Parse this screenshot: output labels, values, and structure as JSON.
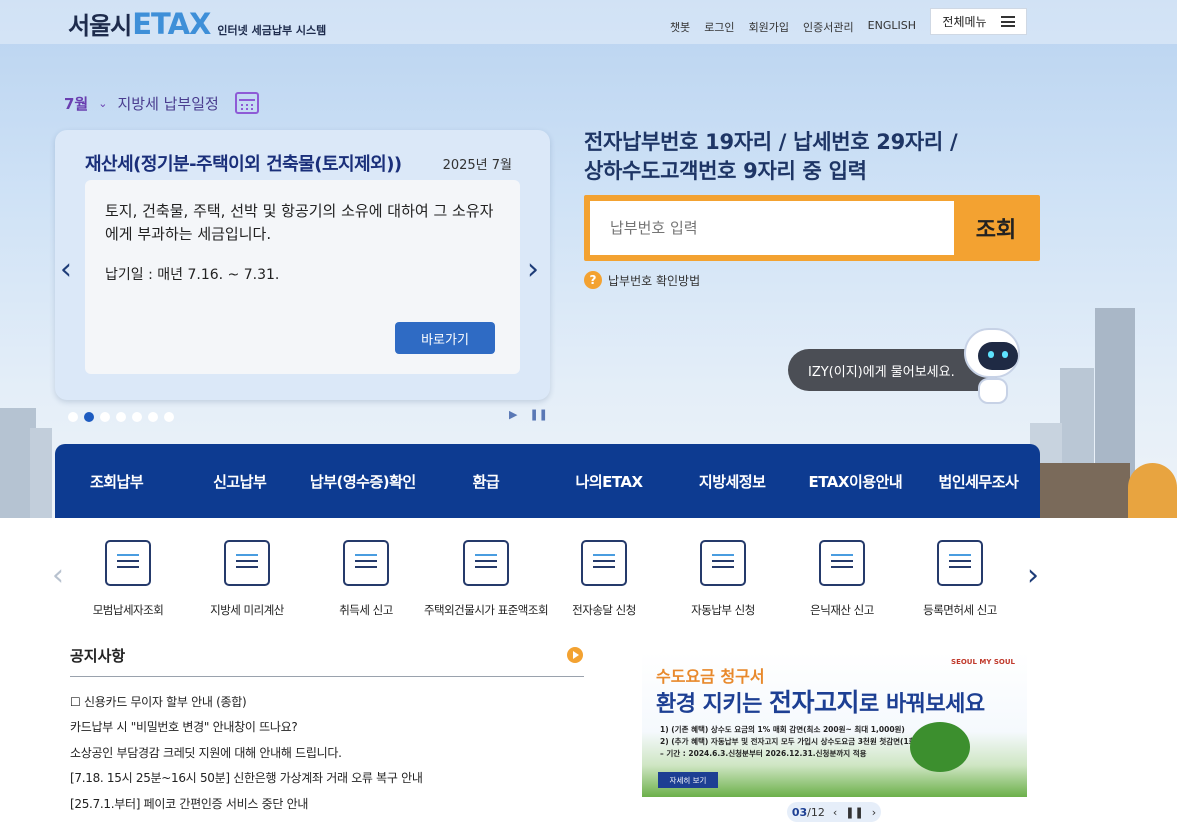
{
  "header": {
    "logo_kr": "서울시",
    "logo_etax": "ETAX",
    "logo_sub": "인터넷 세금납부 시스템",
    "util": [
      "챗봇",
      "로그인",
      "회원가입",
      "인증서관리",
      "ENGLISH"
    ],
    "all_menu": "전체메뉴"
  },
  "schedule": {
    "month": "7월",
    "label": "지방세 납부일정"
  },
  "tax_card": {
    "title": "재산세(정기분-주택이외 건축물(토지제외))",
    "date": "2025년 7월",
    "description": "토지, 건축물, 주택, 선박 및 항공기의 소유에 대하여 그 소유자에게 부과하는 세금입니다.",
    "pay_period": "납기일 : 매년 7.16. ~ 7.31.",
    "button": "바로가기",
    "slides_total": 7,
    "slide_active": 2
  },
  "search": {
    "title_line1": "전자납부번호 19자리 / 납세번호 29자리 /",
    "title_line2": "상하수도고객번호 9자리 중 입력",
    "placeholder": "납부번호 입력",
    "button": "조회",
    "help": "납부번호 확인방법"
  },
  "chatbot": {
    "text": "IZY(이지)에게 물어보세요."
  },
  "nav": [
    "조회납부",
    "신고납부",
    "납부(영수증)확인",
    "환급",
    "나의ETAX",
    "지방세정보",
    "ETAX이용안내",
    "법인세무조사"
  ],
  "quick_menu": [
    {
      "label": "모범납세자조회",
      "icon": "certificate-search-icon"
    },
    {
      "label": "지방세 미리계산",
      "icon": "tax-calculator-icon"
    },
    {
      "label": "취득세 신고",
      "icon": "wallet-icon"
    },
    {
      "label": "주택외건물시가 표준액조회",
      "icon": "house-monitor-icon"
    },
    {
      "label": "전자송달 신청",
      "icon": "email-icon"
    },
    {
      "label": "자동납부 신청",
      "icon": "auto-pay-card-icon"
    },
    {
      "label": "은닉재산 신고",
      "icon": "money-bag-icon"
    },
    {
      "label": "등록면허세 신고",
      "icon": "document-edit-icon"
    }
  ],
  "notice": {
    "title": "공지사항",
    "items": [
      "☐ 신용카드 무이자 할부 안내 (종합)",
      "카드납부 시 \"비밀번호 변경\" 안내창이 뜨나요?",
      "소상공인 부담경감 크레딧 지원에 대해 안내해 드립니다.",
      "[7.18. 15시 25분~16시 50분] 신한은행 가상계좌 거래 오류 복구 안내",
      "[25.7.1.부터] 페이코 간편인증 서비스 중단 안내"
    ]
  },
  "banner": {
    "line1": "수도요금 청구서",
    "line2_a": "환경 지키는 ",
    "line2_b": "전자고지",
    "line2_c": "로 바꿔보세요",
    "detail1": "1) (기존 혜택) 상수도 요금의 1% 매회 감면(최소 200원~ 최대 1,000원)",
    "detail2": "2) (추가 혜택) 자동납부 및 전자고지 모두 가입시 상수도요금 3천원 첫감면(1회)",
    "detail3": "– 기간 : 2024.6.3.신청분부터 2026.12.31.신청분까지 적용",
    "button": "자세히 보기",
    "logo": "SEOUL MY SOUL",
    "pager_current": "03",
    "pager_total": "/12"
  },
  "colors": {
    "nav_bg": "#0d3b91",
    "accent_orange": "#f3a231",
    "button_blue": "#2f6bc4",
    "logo_blue": "#3e8fd8"
  }
}
